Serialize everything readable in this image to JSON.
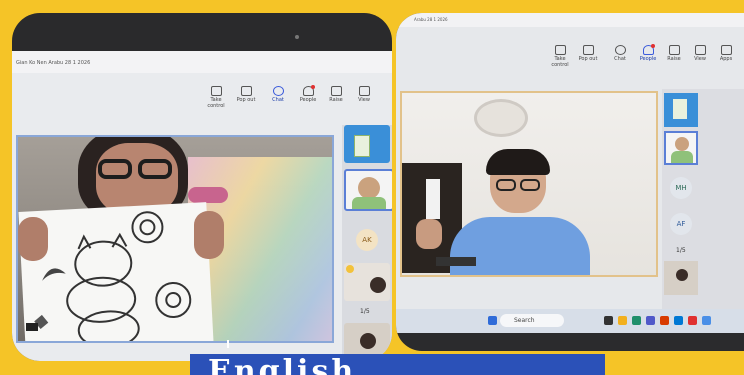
{
  "left_window": {
    "title": "Gian Ko Nen Arabu 28 1 2026",
    "toolbar": [
      {
        "label": "Take control",
        "icon": "take-control-icon"
      },
      {
        "label": "Pop out",
        "icon": "pop-out-icon"
      },
      {
        "label": "Chat",
        "icon": "chat-icon",
        "active": true
      },
      {
        "label": "People",
        "icon": "people-icon"
      },
      {
        "label": "Raise",
        "icon": "raise-hand-icon"
      },
      {
        "label": "View",
        "icon": "view-icon"
      }
    ],
    "participants": [
      "AK"
    ],
    "pager": "1/5"
  },
  "right_window": {
    "title": "Arabu 28 1 2026",
    "toolbar": [
      {
        "label": "Take control",
        "icon": "take-control-icon"
      },
      {
        "label": "Pop out",
        "icon": "pop-out-icon"
      },
      {
        "label": "Chat",
        "icon": "chat-icon"
      },
      {
        "label": "People",
        "icon": "people-icon",
        "active": true
      },
      {
        "label": "Raise",
        "icon": "raise-hand-icon"
      },
      {
        "label": "View",
        "icon": "view-icon"
      },
      {
        "label": "Apps",
        "icon": "apps-icon"
      }
    ],
    "participants": [
      "MH",
      "AF"
    ],
    "pager": "1/5",
    "taskbar": {
      "search_placeholder": "Search"
    }
  },
  "banner": {
    "text": "English",
    "color": "#2b51b8"
  },
  "colors": {
    "frame": "#f5c427",
    "accent": "#3b5bdb"
  }
}
